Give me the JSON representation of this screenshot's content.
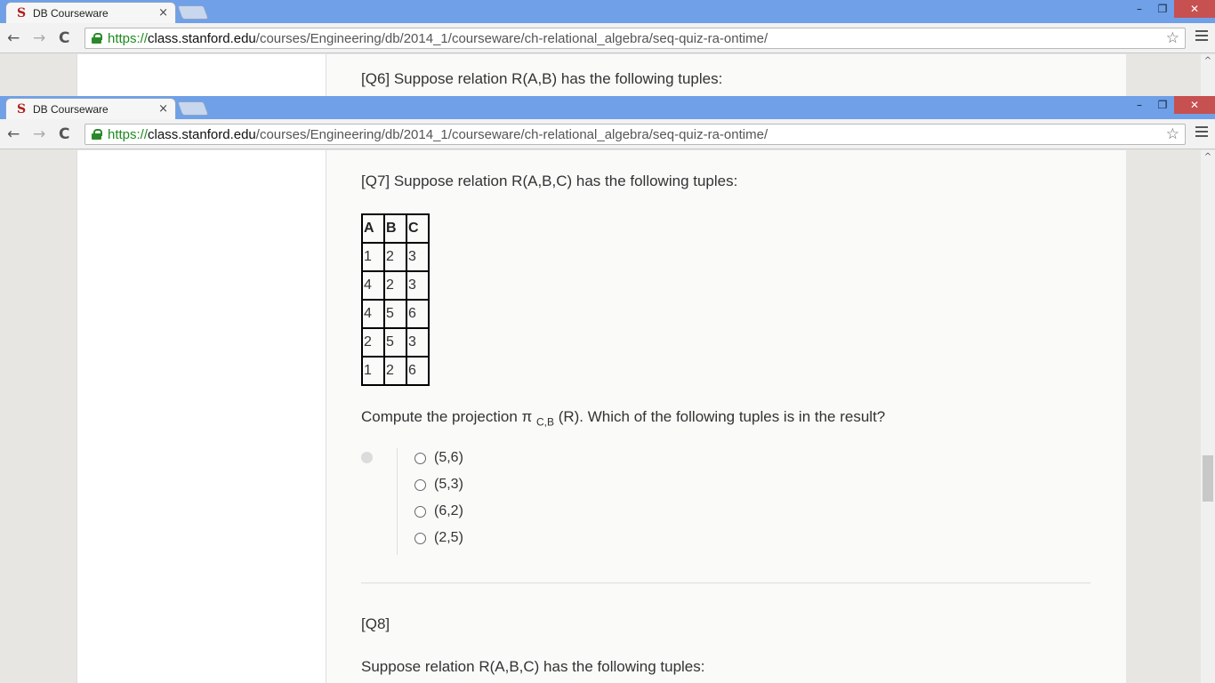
{
  "browser": {
    "tab_title": "DB Courseware",
    "tab_close": "×",
    "favicon": "S",
    "url_scheme": "https://",
    "url_host": "class.stanford.edu",
    "url_path": "/courses/Engineering/db/2014_1/courseware/ch-relational_algebra/seq-quiz-ra-ontime/",
    "back_icon": "←",
    "forward_icon": "→",
    "reload_icon": "C",
    "star_icon": "☆",
    "minimize": "–",
    "restore": "❐",
    "close": "✕",
    "scroll_up": "^"
  },
  "q6": {
    "text": "[Q6] Suppose relation R(A,B) has the following tuples:"
  },
  "q7": {
    "text": "[Q7] Suppose relation R(A,B,C) has the following tuples:",
    "table": {
      "headers": [
        "A",
        "B",
        "C"
      ],
      "rows": [
        [
          "1",
          "2",
          "3"
        ],
        [
          "4",
          "2",
          "3"
        ],
        [
          "4",
          "5",
          "6"
        ],
        [
          "2",
          "5",
          "3"
        ],
        [
          "1",
          "2",
          "6"
        ]
      ]
    },
    "question_prefix": "Compute the projection π",
    "question_sub": "C,B",
    "question_suffix": " (R). Which of the following tuples is in the result?",
    "options": [
      "(5,6)",
      "(5,3)",
      "(6,2)",
      "(2,5)"
    ]
  },
  "q8": {
    "label": "[Q8]",
    "text": "Suppose relation R(A,B,C) has the following tuples:"
  }
}
